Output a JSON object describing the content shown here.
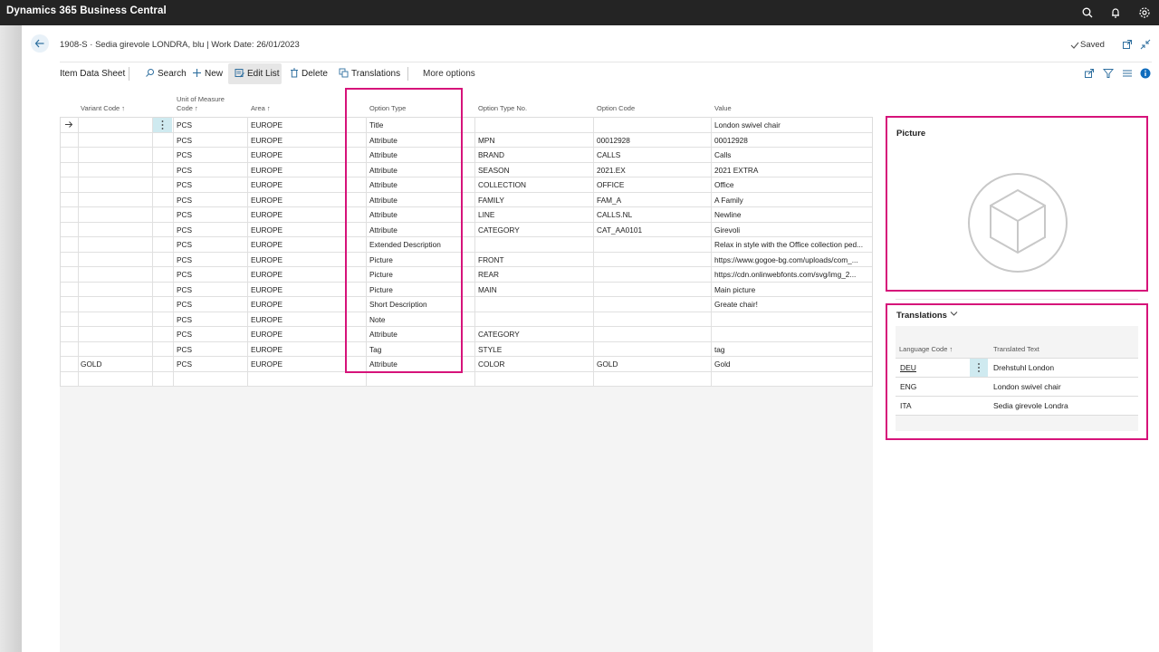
{
  "app": {
    "brand": "Dynamics 365 Business Central"
  },
  "header": {
    "title": "1908-S · Sedia girevole LONDRA, blu | Work Date: 26/01/2023",
    "saved_label": "Saved"
  },
  "actions": {
    "item_data_sheet": "Item Data Sheet",
    "search": "Search",
    "new": "New",
    "edit_list": "Edit List",
    "delete": "Delete",
    "translations": "Translations",
    "more_options": "More options"
  },
  "grid": {
    "columns": {
      "variant_code": "Variant Code ↑",
      "uom_line1": "Unit of Measure",
      "uom_line2": "Code ↑",
      "area": "Area ↑",
      "option_type": "Option Type",
      "option_type_no": "Option Type No.",
      "option_code": "Option Code",
      "value": "Value"
    },
    "rows": [
      {
        "variant": "",
        "uom": "PCS",
        "area": "EUROPE",
        "type": "Title",
        "type_no": "",
        "code": "",
        "value": "London swivel chair"
      },
      {
        "variant": "",
        "uom": "PCS",
        "area": "EUROPE",
        "type": "Attribute",
        "type_no": "MPN",
        "code": "00012928",
        "value": "00012928"
      },
      {
        "variant": "",
        "uom": "PCS",
        "area": "EUROPE",
        "type": "Attribute",
        "type_no": "BRAND",
        "code": "CALLS",
        "value": "Calls"
      },
      {
        "variant": "",
        "uom": "PCS",
        "area": "EUROPE",
        "type": "Attribute",
        "type_no": "SEASON",
        "code": "2021.EX",
        "value": "2021 EXTRA"
      },
      {
        "variant": "",
        "uom": "PCS",
        "area": "EUROPE",
        "type": "Attribute",
        "type_no": "COLLECTION",
        "code": "OFFICE",
        "value": "Office"
      },
      {
        "variant": "",
        "uom": "PCS",
        "area": "EUROPE",
        "type": "Attribute",
        "type_no": "FAMILY",
        "code": "FAM_A",
        "value": "A Family"
      },
      {
        "variant": "",
        "uom": "PCS",
        "area": "EUROPE",
        "type": "Attribute",
        "type_no": "LINE",
        "code": "CALLS.NL",
        "value": "Newline"
      },
      {
        "variant": "",
        "uom": "PCS",
        "area": "EUROPE",
        "type": "Attribute",
        "type_no": "CATEGORY",
        "code": "CAT_AA0101",
        "value": "Girevoli"
      },
      {
        "variant": "",
        "uom": "PCS",
        "area": "EUROPE",
        "type": "Extended Description",
        "type_no": "",
        "code": "",
        "value": "Relax in style with the Office collection ped..."
      },
      {
        "variant": "",
        "uom": "PCS",
        "area": "EUROPE",
        "type": "Picture",
        "type_no": "FRONT",
        "code": "",
        "value": "https://www.gogoe-bg.com/uploads/com_..."
      },
      {
        "variant": "",
        "uom": "PCS",
        "area": "EUROPE",
        "type": "Picture",
        "type_no": "REAR",
        "code": "",
        "value": "https://cdn.onlinwebfonts.com/svg/img_2..."
      },
      {
        "variant": "",
        "uom": "PCS",
        "area": "EUROPE",
        "type": "Picture",
        "type_no": "MAIN",
        "code": "",
        "value": "Main picture"
      },
      {
        "variant": "",
        "uom": "PCS",
        "area": "EUROPE",
        "type": "Short Description",
        "type_no": "",
        "code": "",
        "value": "Greate chair!"
      },
      {
        "variant": "",
        "uom": "PCS",
        "area": "EUROPE",
        "type": "Note",
        "type_no": "",
        "code": "",
        "value": ""
      },
      {
        "variant": "",
        "uom": "PCS",
        "area": "EUROPE",
        "type": "Attribute",
        "type_no": "CATEGORY",
        "code": "",
        "value": ""
      },
      {
        "variant": "",
        "uom": "PCS",
        "area": "EUROPE",
        "type": "Tag",
        "type_no": "STYLE",
        "code": "",
        "value": "tag"
      },
      {
        "variant": "GOLD",
        "uom": "PCS",
        "area": "EUROPE",
        "type": "Attribute",
        "type_no": "COLOR",
        "code": "GOLD",
        "value": "Gold"
      },
      {
        "variant": "",
        "uom": "",
        "area": "",
        "type": "",
        "type_no": "",
        "code": "",
        "value": ""
      }
    ]
  },
  "picture": {
    "title": "Picture",
    "icon": "cube-placeholder-icon"
  },
  "translations": {
    "title": "Translations",
    "col_language": "Language Code ↑",
    "col_text": "Translated Text",
    "rows": [
      {
        "code": "DEU",
        "text": "Drehstuhl London"
      },
      {
        "code": "ENG",
        "text": "London swivel chair"
      },
      {
        "code": "ITA",
        "text": "Sedia girevole Londra"
      }
    ]
  },
  "colors": {
    "highlight": "#d6137a",
    "topbar": "#242424",
    "selected_cell": "#cfeaf0"
  }
}
